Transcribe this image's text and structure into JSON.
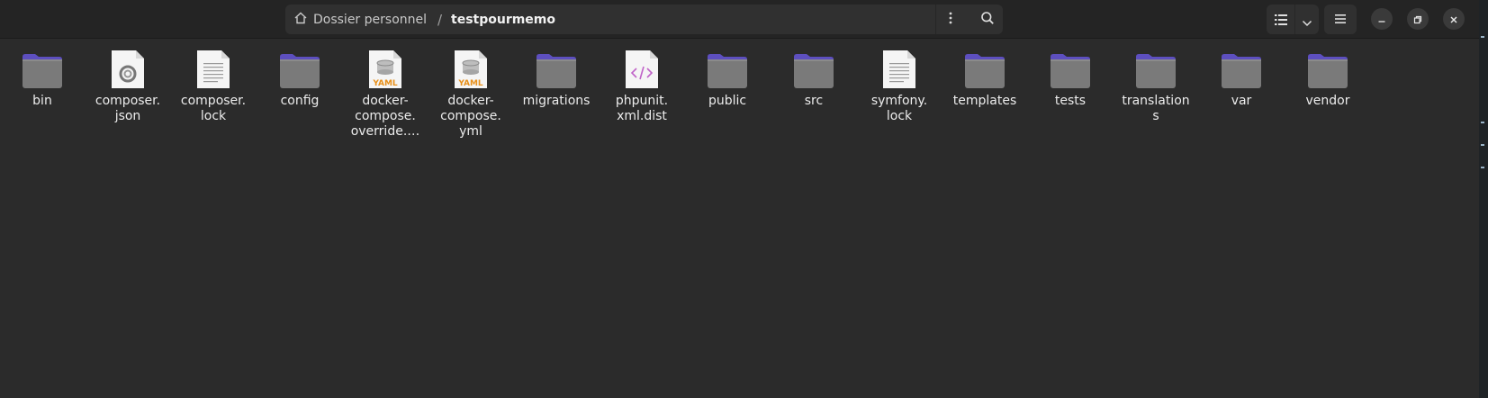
{
  "pathbar": {
    "home_label": "Dossier personnel",
    "separator": "/",
    "current": "testpourmemo"
  },
  "icons": {
    "home": "home-icon",
    "path_menu": "vertical-dots-icon",
    "search": "search-icon",
    "view_list": "list-view-icon",
    "view_dropdown": "chevron-down-icon",
    "menu": "hamburger-menu-icon",
    "minimize": "minimize-icon",
    "maximize": "restore-icon",
    "close": "close-icon"
  },
  "colors": {
    "folder_body": "#787878",
    "folder_tab": "#6a5acd",
    "background": "#2b2b2b",
    "headerbar": "#242424"
  },
  "files": [
    {
      "name": "bin",
      "label": "bin",
      "kind": "folder"
    },
    {
      "name": "composer-json",
      "label": "composer.\njson",
      "kind": "json"
    },
    {
      "name": "composer-lock",
      "label": "composer.\nlock",
      "kind": "text"
    },
    {
      "name": "config",
      "label": "config",
      "kind": "folder"
    },
    {
      "name": "docker-compose-override",
      "label": "docker-\ncompose.\noverride.…",
      "kind": "yaml"
    },
    {
      "name": "docker-compose-yml",
      "label": "docker-\ncompose.\nyml",
      "kind": "yaml"
    },
    {
      "name": "migrations",
      "label": "migrations",
      "kind": "folder"
    },
    {
      "name": "phpunit-xml-dist",
      "label": "phpunit.\nxml.dist",
      "kind": "xml"
    },
    {
      "name": "public",
      "label": "public",
      "kind": "folder"
    },
    {
      "name": "src",
      "label": "src",
      "kind": "folder"
    },
    {
      "name": "symfony-lock",
      "label": "symfony.\nlock",
      "kind": "text"
    },
    {
      "name": "templates",
      "label": "templates",
      "kind": "folder"
    },
    {
      "name": "tests",
      "label": "tests",
      "kind": "folder"
    },
    {
      "name": "translations",
      "label": "translation\ns",
      "kind": "folder"
    },
    {
      "name": "var",
      "label": "var",
      "kind": "folder"
    },
    {
      "name": "vendor",
      "label": "vendor",
      "kind": "folder"
    }
  ]
}
